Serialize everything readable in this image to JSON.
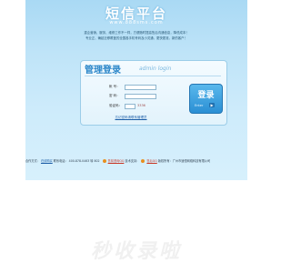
{
  "header": {
    "title": "短信平台",
    "url": "www.888sms.com"
  },
  "intro": {
    "line1": "重企营销、服务、维修工作不一样，方便随时提高售后沟通信息，降低成本！",
    "line2": "专业正、确起迁移覆盖的全国各手机号码及小灵通，更快更准，新的客户！"
  },
  "login": {
    "title": "管理登录",
    "subtitle": "admin login",
    "username_label": "帐  号：",
    "password_label": "密  码：",
    "captcha_label": "验证码：",
    "captcha_code": "3336",
    "button_label": "登录",
    "enter_label": "Enter",
    "forgot_link": "忘记密码请联系管理员"
  },
  "footer": {
    "prefix": "合作方式：",
    "link1": "在线购买",
    "sep1": " 联系电话：",
    "phone": "400-878-0463 转 802",
    "sep2": " ",
    "link2": "售前咨询QQ",
    "sep3": " 技术支持：",
    "link3": "售后QQ",
    "sep4": " 版权所有：广州市速恒网络科技有限公司"
  },
  "watermark": "秒收录啦"
}
